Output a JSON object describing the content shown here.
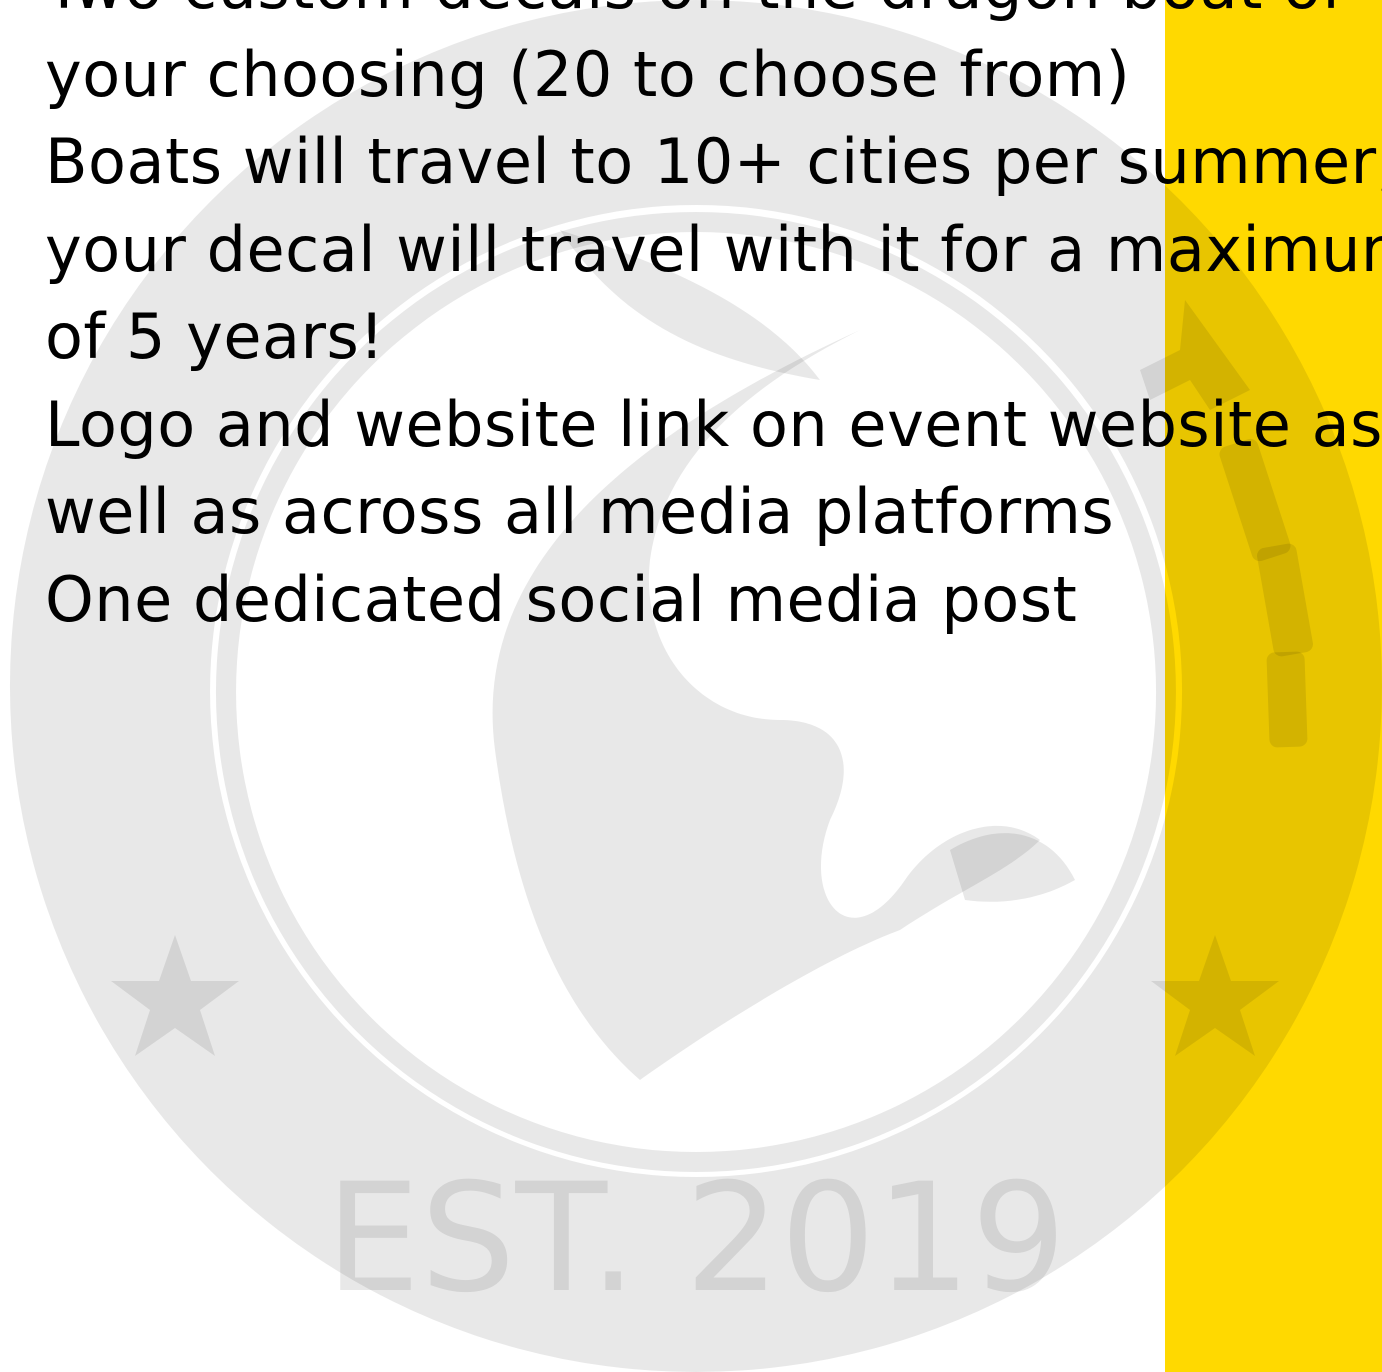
{
  "colors": {
    "background": "#ffffff",
    "accent": "#ffd900",
    "watermark": "#000000",
    "text": "#000000"
  },
  "watermark": {
    "icon": "dragon-boat-festival-seal",
    "visible_text": "EST. 2019"
  },
  "benefits": [
    "Two custom decals on the dragon boat of",
    "your choosing (20 to choose from)",
    "Boats will travel to 10+ cities per summer;",
    "your decal will travel with it for a maximum",
    "of 5 years!",
    "Logo and website link on event website as",
    "well as across all media platforms",
    "One dedicated social media post"
  ]
}
